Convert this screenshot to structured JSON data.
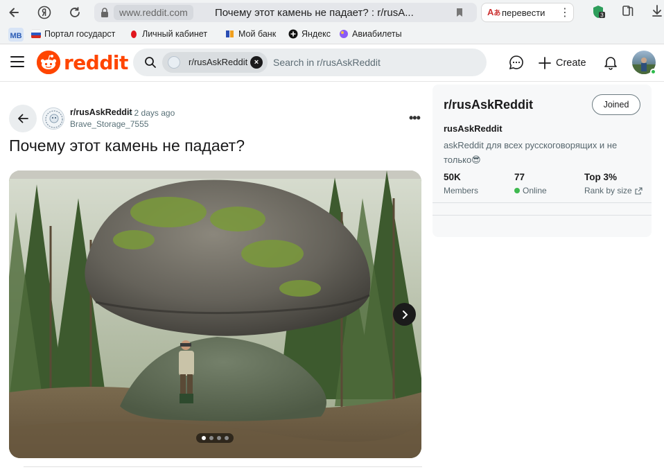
{
  "browser": {
    "domain": "www.reddit.com",
    "tab_title": "Почему этот камень не падает? : r/rusA...",
    "translate_label": "перевести",
    "extension_badge": "3"
  },
  "bookmarks": [
    {
      "label": "Портал государст",
      "icon": "russia-flag-icon"
    },
    {
      "label": "Личный кабинет",
      "icon": "red-drop-icon"
    },
    {
      "label": "Мой банк",
      "icon": "bank-icon"
    },
    {
      "label": "Яндекс",
      "icon": "plus-circle-icon"
    },
    {
      "label": "Авиабилеты",
      "icon": "planet-icon"
    }
  ],
  "reddit": {
    "logo_text": "reddit",
    "search": {
      "chip_label": "r/rusAskReddit",
      "placeholder": "Search in r/rusAskReddit"
    },
    "create_label": "Create"
  },
  "post": {
    "subreddit": "r/rusAskReddit",
    "time": "• 2 days ago",
    "author": "Brave_Storage_7555",
    "title": "Почему этот камень не падает?",
    "gallery": {
      "current": 1,
      "total": 4
    }
  },
  "sidebar": {
    "title": "r/rusAskReddit",
    "joined_label": "Joined",
    "name": "rusAskReddit",
    "description": "askReddit для всех русскоговорящих и не только😎",
    "stats": [
      {
        "value": "50K",
        "label": "Members"
      },
      {
        "value": "77",
        "label": "Online"
      },
      {
        "value": "Top 3%",
        "label": "Rank by size"
      }
    ]
  },
  "colors": {
    "brand": "#ff4500",
    "online": "#3fb950"
  }
}
